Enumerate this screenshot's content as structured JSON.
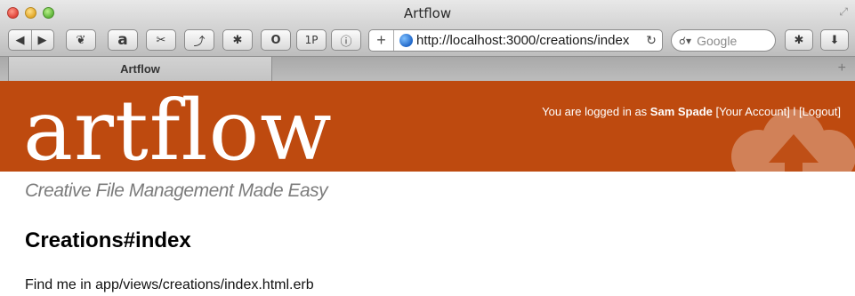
{
  "window": {
    "title": "Artflow"
  },
  "toolbar": {
    "back_icon": "◀",
    "forward_icon": "▶",
    "url": "http://localhost:3000/creations/index",
    "search_placeholder": "Google",
    "extensions": [
      {
        "name": "leaf",
        "glyph": "❦"
      },
      {
        "name": "amazon",
        "glyph": "a"
      },
      {
        "name": "delicious",
        "glyph": "✂"
      },
      {
        "name": "readability",
        "glyph": "⤴"
      },
      {
        "name": "debug",
        "glyph": "✱"
      },
      {
        "name": "circle",
        "glyph": "O"
      },
      {
        "name": "1password",
        "glyph": "1P"
      },
      {
        "name": "info",
        "glyph": "ⓘ"
      }
    ]
  },
  "tabs": [
    {
      "label": "Artflow"
    }
  ],
  "banner": {
    "color": "#be4a0f",
    "logo": "artflow",
    "logged_in_prefix": "You are logged in as ",
    "user_name": "Sam Spade",
    "account_link": "[Your Account]",
    "separator": " l ",
    "logout_link": "[Logout]"
  },
  "tagline": "Creative File Management Made Easy",
  "page": {
    "title": "Creations#index",
    "text": "Find me in app/views/creations/index.html.erb"
  }
}
